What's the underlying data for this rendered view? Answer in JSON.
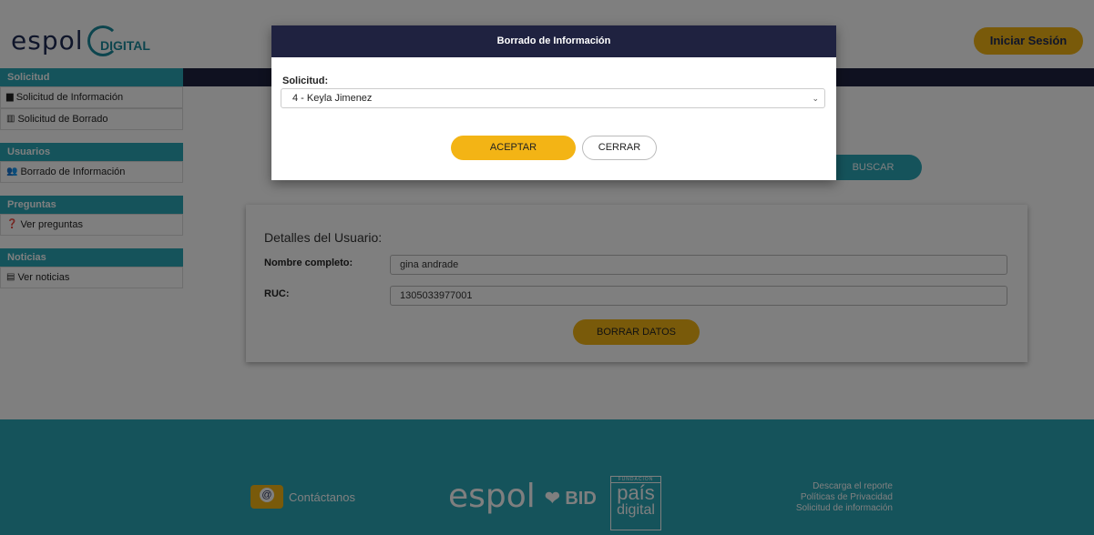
{
  "header": {
    "logo_text": "espol",
    "logo_digital_text": "DIGITAL",
    "login_label": "Iniciar Sesión"
  },
  "sidebar": {
    "sections": [
      {
        "title": "Solicitud",
        "items": [
          {
            "label": "Solicitud de Información",
            "icon": "file-icon"
          },
          {
            "label": "Solicitud de Borrado",
            "icon": "trash-icon"
          }
        ]
      },
      {
        "title": "Usuarios",
        "items": [
          {
            "label": "Borrado de Información",
            "icon": "users-icon"
          }
        ]
      },
      {
        "title": "Preguntas",
        "items": [
          {
            "label": "Ver preguntas",
            "icon": "question-icon"
          }
        ]
      },
      {
        "title": "Noticias",
        "items": [
          {
            "label": "Ver noticias",
            "icon": "newspaper-icon"
          }
        ]
      }
    ]
  },
  "main": {
    "search_label": "BUSCAR",
    "card": {
      "title": "Detalles del Usuario:",
      "name_label": "Nombre completo:",
      "name_value": "gina andrade",
      "ruc_label": "RUC:",
      "ruc_value": "1305033977001",
      "erase_label": "BORRAR DATOS"
    }
  },
  "modal": {
    "title": "Borrado de Información",
    "select_label": "Solicitud:",
    "select_value": "4 - Keyla Jimenez",
    "accept_label": "ACEPTAR",
    "close_label": "CERRAR"
  },
  "footer": {
    "contact_label": "Contáctanos",
    "espol_text": "espol",
    "bid_text": "BID",
    "pais_fundacion": "FUNDACIÓN",
    "pais_text": "país",
    "digital_text": "digital",
    "links": [
      "Descarga el reporte",
      "Políticas de Privacidad",
      "Solicitud de información"
    ]
  },
  "colors": {
    "accent_teal": "#2aa6b7",
    "accent_yellow": "#f3b415",
    "navy": "#1f2240"
  }
}
